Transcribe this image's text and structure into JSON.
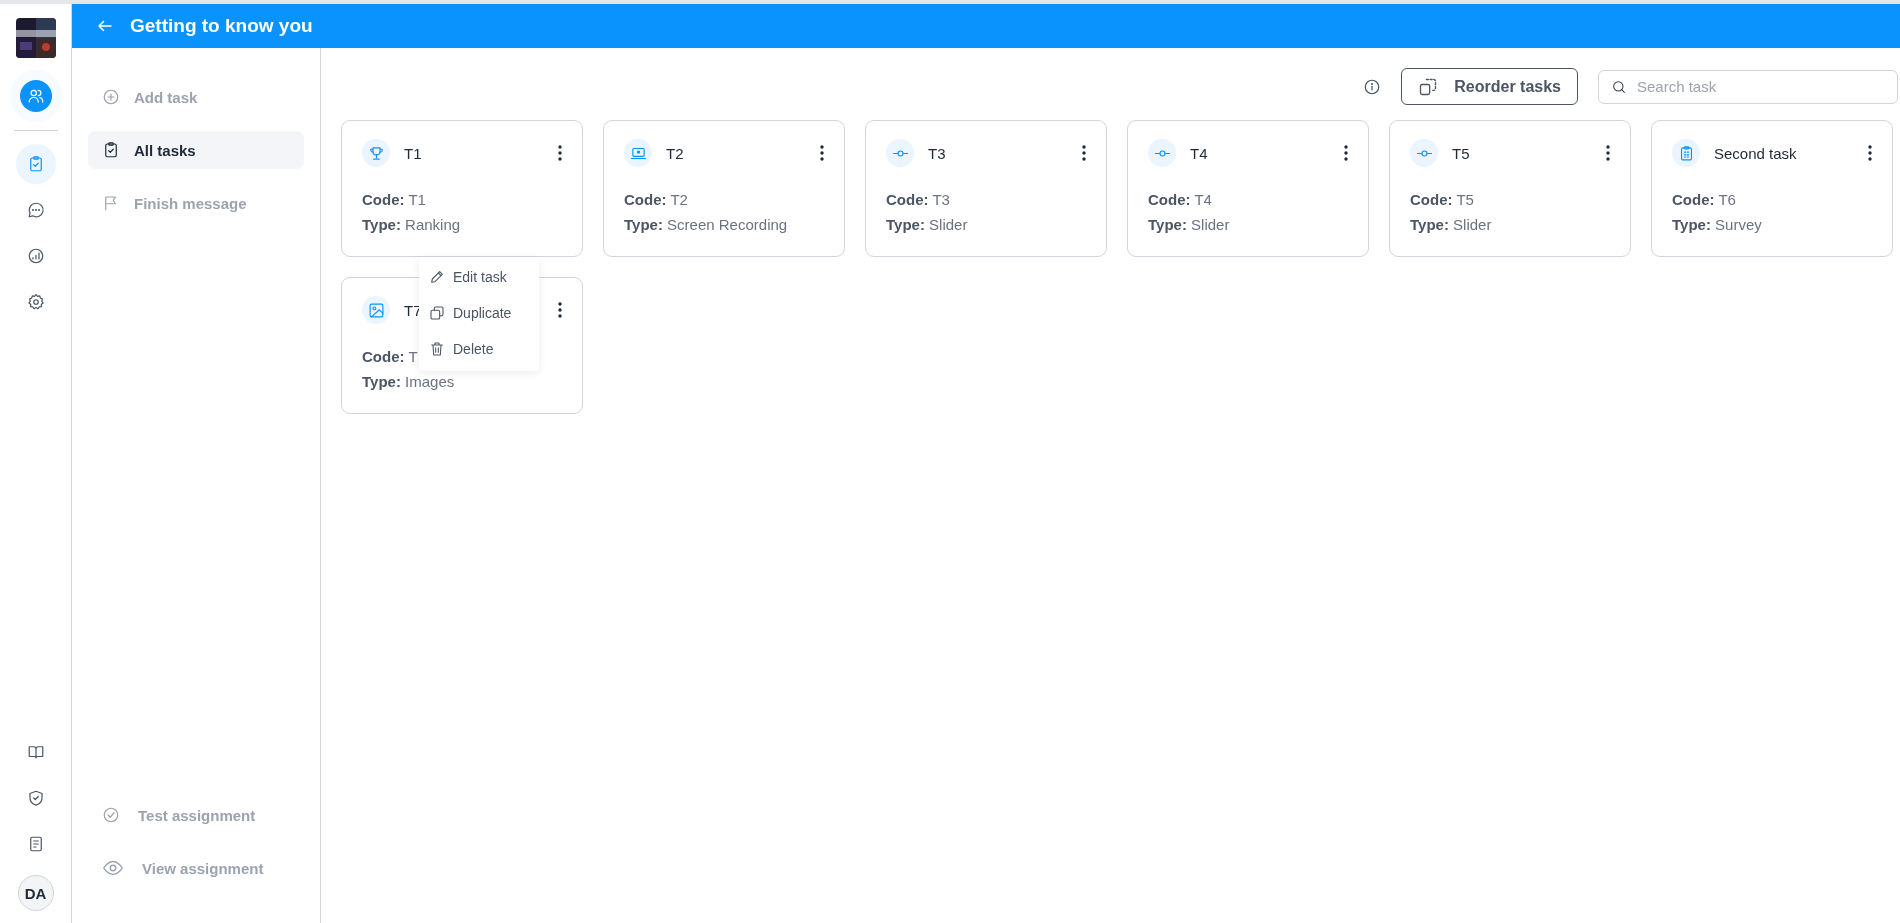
{
  "header": {
    "title": "Getting to know you"
  },
  "rail": {
    "items": [
      {
        "selected": true
      },
      {
        "selected": false
      },
      {
        "selected": false
      },
      {
        "selected": false
      }
    ],
    "avatar": "DA"
  },
  "sidebar": {
    "items": [
      {
        "label": "Add task",
        "selected": false
      },
      {
        "label": "All tasks",
        "selected": true
      },
      {
        "label": "Finish message",
        "selected": false
      }
    ],
    "bottom_items": [
      {
        "label": "Test assignment"
      },
      {
        "label": "View assignment"
      }
    ]
  },
  "toolbar": {
    "reorder_button": "Reorder tasks",
    "search": {
      "placeholder": "Search task"
    }
  },
  "tasks": [
    {
      "title": "T1",
      "kind": "ranking",
      "code_label": "Code:",
      "code": "T1",
      "type_label": "Type:",
      "type": "Ranking"
    },
    {
      "title": "T2",
      "kind": "screen",
      "code_label": "Code:",
      "code": "T2",
      "type_label": "Type:",
      "type": "Screen Recording"
    },
    {
      "title": "T3",
      "kind": "slider",
      "code_label": "Code:",
      "code": "T3",
      "type_label": "Type:",
      "type": "Slider"
    },
    {
      "title": "T4",
      "kind": "slider",
      "code_label": "Code:",
      "code": "T4",
      "type_label": "Type:",
      "type": "Slider"
    },
    {
      "title": "T5",
      "kind": "slider",
      "code_label": "Code:",
      "code": "T5",
      "type_label": "Type:",
      "type": "Slider"
    },
    {
      "title": "Second task",
      "kind": "survey",
      "code_label": "Code:",
      "code": "T6",
      "type_label": "Type:",
      "type": "Survey"
    },
    {
      "title": "T7",
      "kind": "images",
      "code_label": "Code:",
      "code": "T",
      "type_label": "Type:",
      "type": "Images"
    }
  ],
  "context_menu": {
    "items": [
      {
        "label": "Edit task"
      },
      {
        "label": "Duplicate"
      },
      {
        "label": "Delete"
      }
    ]
  }
}
